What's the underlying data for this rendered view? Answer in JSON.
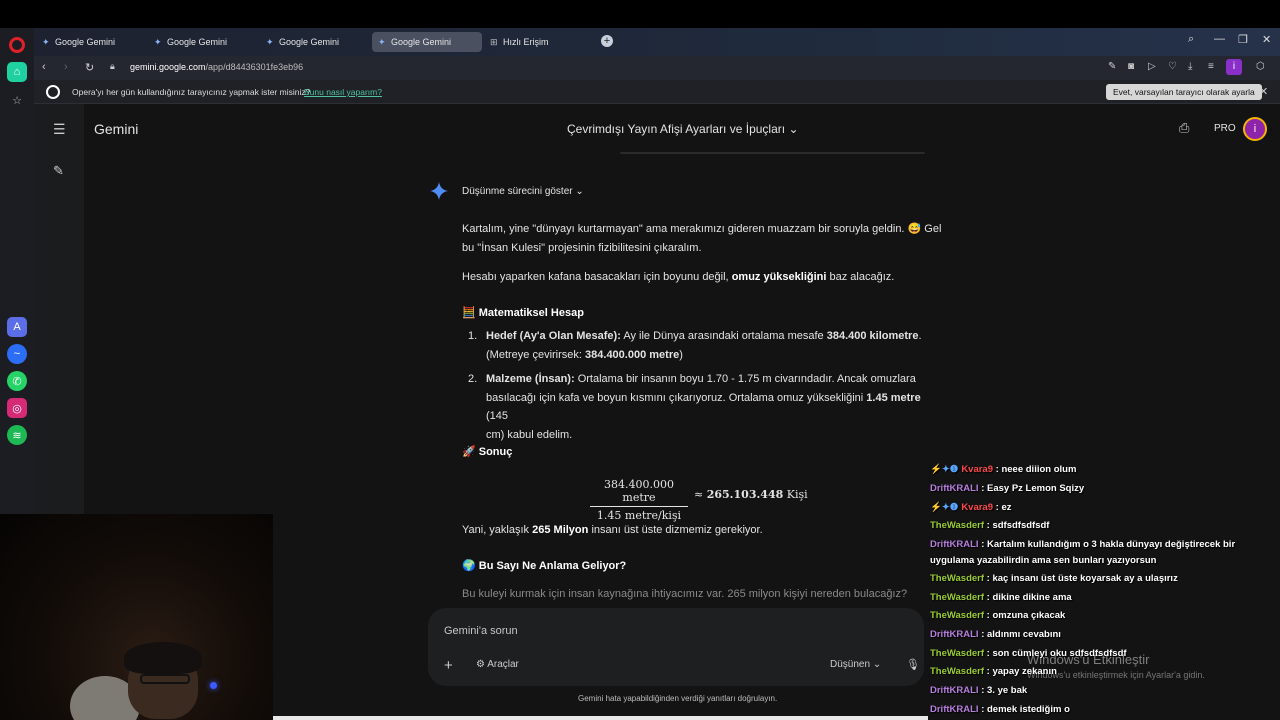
{
  "browser": {
    "tabs": [
      {
        "label": "Google Gemini",
        "icon": "gemini-icon"
      },
      {
        "label": "Google Gemini",
        "icon": "gemini-icon"
      },
      {
        "label": "Google Gemini",
        "icon": "gemini-icon"
      },
      {
        "label": "Google Gemini",
        "icon": "gemini-icon",
        "active": true
      },
      {
        "label": "Hızlı Erişim",
        "icon": "speed-dial-icon"
      }
    ],
    "url_host": "gemini.google.com",
    "url_path": "/app/d84436301fe3eb96",
    "extension_badge": "i",
    "infobar": {
      "text": "Opera'yı her gün kullandığınız tarayıcınız yapmak ister misiniz?",
      "link": "Bunu nasıl yaparım?",
      "button": "Evet, varsayılan tarayıcı olarak ayarla"
    },
    "accent_color": "#e0202a"
  },
  "gemini": {
    "app_title": "Gemini",
    "chat_title": "Çevrimdışı Yayın Afişi Ayarları ve İpuçları",
    "pro_label": "PRO",
    "avatar_letter": "i",
    "show_thinking": "Düşünme sürecini göster",
    "para1_a": "Kartalım, yine \"dünyayı kurtarmayan\" ama merakımızı gideren muazzam bir soruyla geldin. 😅 Gel",
    "para1_b": "bu \"İnsan Kulesi\" projesinin fizibilitesini çıkaralım.",
    "para2_a": "Hesabı yaparken kafana basacakları için boyunu değil,",
    "para2_b": "omuz yüksekliğini",
    "para2_c": "baz alacağız.",
    "heading_math": "🧮 Matematiksel Hesap",
    "item1_num": "1.",
    "item1_bold": "Hedef (Ay'a Olan Mesafe):",
    "item1_text": "Ay ile Dünya arasındaki ortalama mesafe",
    "item1_value": "384.400 kilometre",
    "item1_line2_a": "(Metreye çevirirsek:",
    "item1_line2_b": "384.400.000 metre",
    "item1_line2_c": ")",
    "item2_num": "2.",
    "item2_bold": "Malzeme (İnsan):",
    "item2_text": "Ortalama bir insanın boyu 1.70 - 1.75 m civarındadır. Ancak omuzlara",
    "item2_line2_a": "basılacağı için kafa ve boyun kısmını çıkarıyoruz. Ortalama omuz yüksekliğini",
    "item2_line2_b": "1.45 metre",
    "item2_line2_c": "(145",
    "item2_line3": "cm) kabul edelim.",
    "heading_result": "🚀 Sonuç",
    "formula_num": "384.400.000 metre",
    "formula_den": "1.45 metre/kişi",
    "formula_approx": "≈",
    "formula_result": "265.103.448",
    "formula_unit": "Kişi",
    "para3_a": "Yani, yaklaşık",
    "para3_b": "265 Milyon",
    "para3_c": "insanı üst üste dizmemiz gerekiyor.",
    "heading_meaning": "🌍 Bu Sayı Ne Anlama Geliyor?",
    "faded_text": "Bu kuleyi kurmak için insan kaynağına ihtiyacımız var. 265 milyon kişiyi nereden bulacağız?",
    "input_placeholder": "Gemini'a sorun",
    "tools_label": "Araçlar",
    "model_label": "Düşünen",
    "disclaimer": "Gemini hata yapabildiğinden verdiği yanıtları doğrulayın."
  },
  "chat": [
    {
      "user": "Kvara9",
      "color": "red",
      "badges": "⚡✦❶",
      "msg": ": neee diiion olum"
    },
    {
      "user": "DriftKRALI",
      "color": "purple",
      "msg": ": Easy Pz Lemon Sqizy"
    },
    {
      "user": "Kvara9",
      "color": "red",
      "badges": "⚡✦❶",
      "msg": ": ez"
    },
    {
      "user": "TheWasderf",
      "color": "green",
      "msg": ": sdfsdfsdfsdf"
    },
    {
      "user": "DriftKRALI",
      "color": "purple",
      "msg": ": Kartalım kullandığım o 3 hakla dünyayı değiştirecek bir uygulama yazabilirdin ama sen bunları yazıyorsun"
    },
    {
      "user": "TheWasderf",
      "color": "green",
      "msg": ": kaç insanı üst üste koyarsak ay a ulaşırız"
    },
    {
      "user": "TheWasderf",
      "color": "green",
      "msg": ": dikine dikine ama"
    },
    {
      "user": "TheWasderf",
      "color": "green",
      "msg": ": omzuna çıkacak"
    },
    {
      "user": "DriftKRALI",
      "color": "purple",
      "msg": ": aldınmı cevabını"
    },
    {
      "user": "TheWasderf",
      "color": "green",
      "msg": ": son cümleyi oku sdfsdfsdfsdf"
    },
    {
      "user": "TheWasderf",
      "color": "green",
      "msg": ": yapay zekanın"
    },
    {
      "user": "DriftKRALI",
      "color": "purple",
      "msg": ": 3. ye bak"
    },
    {
      "user": "DriftKRALI",
      "color": "purple",
      "msg": ": demek istediğim o"
    }
  ],
  "watermark": {
    "title": "Windows'u Etkinleştir",
    "subtitle": "Windows'u etkinleştirmek için Ayarlar'a gidin."
  }
}
